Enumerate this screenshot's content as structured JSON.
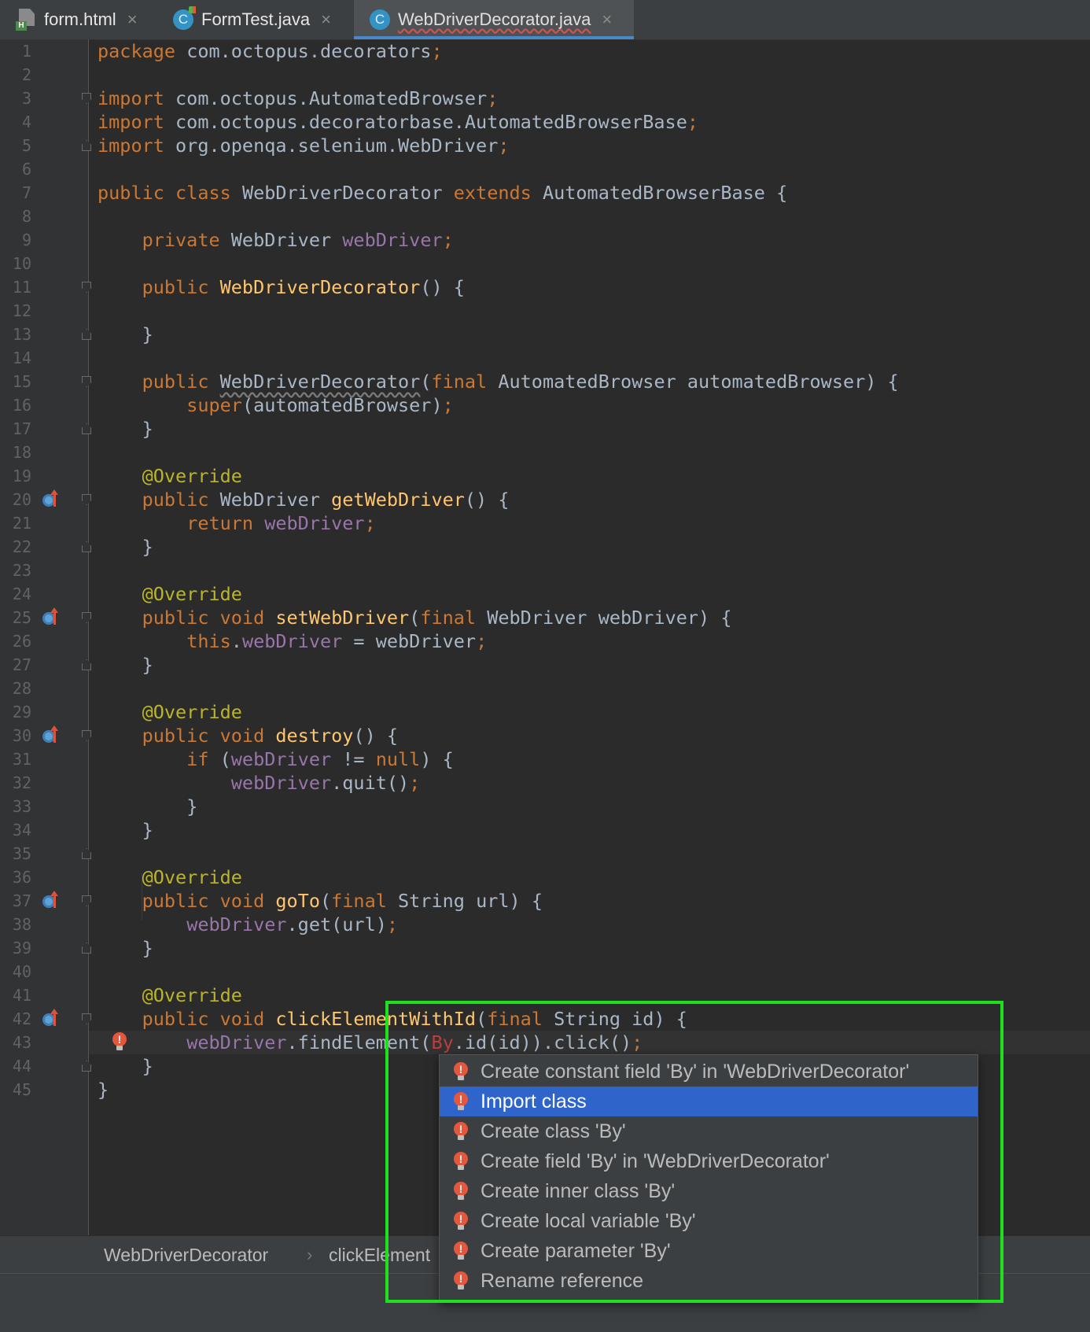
{
  "tabs": [
    {
      "label": "form.html",
      "icon": "html-file-icon",
      "active": false
    },
    {
      "label": "FormTest.java",
      "icon": "java-class-icon",
      "active": false
    },
    {
      "label": "WebDriverDecorator.java",
      "icon": "java-class-icon",
      "active": true
    }
  ],
  "tab_close_glyph": "×",
  "editor": {
    "line_numbers": [
      "1",
      "2",
      "3",
      "4",
      "5",
      "6",
      "7",
      "8",
      "9",
      "10",
      "11",
      "12",
      "13",
      "14",
      "15",
      "16",
      "17",
      "18",
      "19",
      "20",
      "21",
      "22",
      "23",
      "24",
      "25",
      "26",
      "27",
      "28",
      "29",
      "30",
      "31",
      "32",
      "33",
      "34",
      "35",
      "36",
      "37",
      "38",
      "39",
      "40",
      "41",
      "42",
      "43",
      "44",
      "45"
    ],
    "code": {
      "l1_kw": "package",
      "l1_rest": " com.octopus.decorators",
      "semi": ";",
      "import_kw": "import",
      "l3": " com.octopus.AutomatedBrowser",
      "l4": " com.octopus.decoratorbase.AutomatedBrowserBase",
      "l5": " org.openqa.selenium.WebDriver",
      "public": "public",
      "class": "class",
      "extends": "extends",
      "private": "private",
      "void": "void",
      "final": "final",
      "super": "super",
      "return": "return",
      "this": "this",
      "if": "if",
      "null": "null",
      "l7_name": " WebDriverDecorator ",
      "l7_base": " AutomatedBrowserBase {",
      "l9_type": " WebDriver ",
      "webDriver": "webDriver",
      "ctor": "WebDriverDecorator",
      "empty_parens": "() {",
      "close_brace": "}",
      "l15_params": " AutomatedBrowser automatedBrowser) {",
      "open_paren": "(",
      "l16_args": "(automatedBrowser)",
      "override": "@Override",
      "l20_type": " WebDriver ",
      "getWebDriver": "getWebDriver",
      "setWebDriver": "setWebDriver",
      "l25_params": " WebDriver webDriver) {",
      "l26_assign": " = webDriver",
      "dot": ".",
      "destroy": "destroy",
      "l31_open": " (",
      "l31_ne": " != ",
      "l31_close": ") {",
      "quit": ".quit()",
      "goTo": "goTo",
      "l37_params": " String url) {",
      "get_url": ".get(url)",
      "clickElementWithId": "clickElementWithId",
      "l42_params": " String id) {",
      "findElement_open": ".findElement(",
      "By": "By",
      "l43_rest": ".id(id)).click()"
    }
  },
  "breadcrumb": [
    "WebDriverDecorator",
    "clickElement"
  ],
  "breadcrumb_sep": "›",
  "popup": {
    "items": [
      "Create constant field 'By' in 'WebDriverDecorator'",
      "Import class",
      "Create class 'By'",
      "Create field 'By' in 'WebDriverDecorator'",
      "Create inner class 'By'",
      "Create local variable 'By'",
      "Create parameter 'By'",
      "Rename reference"
    ],
    "selected_index": 1
  },
  "colors": {
    "keyword": "#cc7832",
    "field": "#9876aa",
    "method": "#ffc66d",
    "annotation": "#bbb529",
    "error": "#bc3f3c",
    "selection": "#2f65ca",
    "highlight_box": "#1ee01e"
  }
}
